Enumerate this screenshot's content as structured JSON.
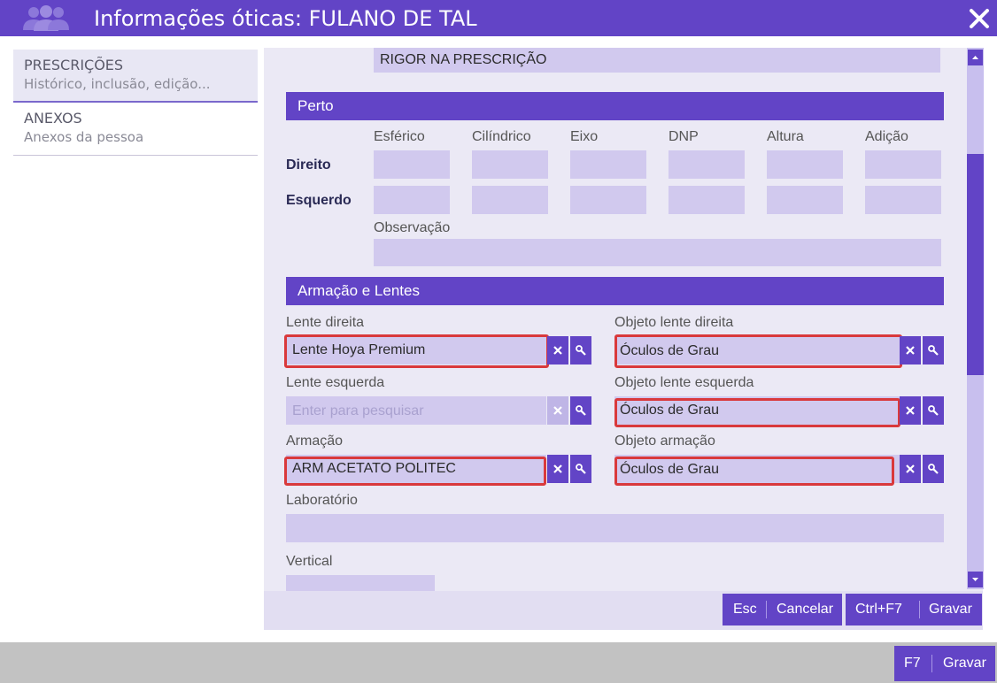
{
  "window": {
    "title": "Informações óticas: FULANO DE TAL"
  },
  "sidebar": {
    "items": [
      {
        "title": "PRESCRIÇÕES",
        "subtitle": "Histórico, inclusão, edição..."
      },
      {
        "title": "ANEXOS",
        "subtitle": "Anexos da pessoa"
      }
    ]
  },
  "form": {
    "rigor_value": "RIGOR NA PRESCRIÇÃO",
    "perto": {
      "section_title": "Perto",
      "columns": [
        "Esférico",
        "Cilíndrico",
        "Eixo",
        "DNP",
        "Altura",
        "Adição"
      ],
      "rows": [
        "Direito",
        "Esquerdo"
      ],
      "observation_label": "Observação"
    },
    "armacao": {
      "section_title": "Armação e Lentes",
      "lente_direita": {
        "label": "Lente direita",
        "value": "Lente Hoya Premium"
      },
      "objeto_lente_direita": {
        "label": "Objeto lente direita",
        "value": "Óculos de Grau"
      },
      "lente_esquerda": {
        "label": "Lente esquerda",
        "placeholder": "Enter para pesquisar"
      },
      "objeto_lente_esquerda": {
        "label": "Objeto lente esquerda",
        "value": "Óculos de Grau"
      },
      "armacao": {
        "label": "Armação",
        "value": "ARM ACETATO POLITEC"
      },
      "objeto_armacao": {
        "label": "Objeto armação",
        "value": "Óculos de Grau"
      },
      "laboratorio": {
        "label": "Laboratório"
      },
      "vertical": {
        "label": "Vertical"
      }
    }
  },
  "actions": {
    "esc_key": "Esc",
    "cancel_label": "Cancelar",
    "save_key": "Ctrl+F7",
    "save_label": "Gravar"
  },
  "footer": {
    "save_key": "F7",
    "save_label": "Gravar"
  },
  "icons": {
    "clear": "close-x-icon",
    "search": "magnifier-icon",
    "users": "users-icon",
    "close": "close-icon"
  },
  "colors": {
    "accent": "#6244c6",
    "field": "#d1c9ee",
    "highlight": "#d9393c"
  }
}
